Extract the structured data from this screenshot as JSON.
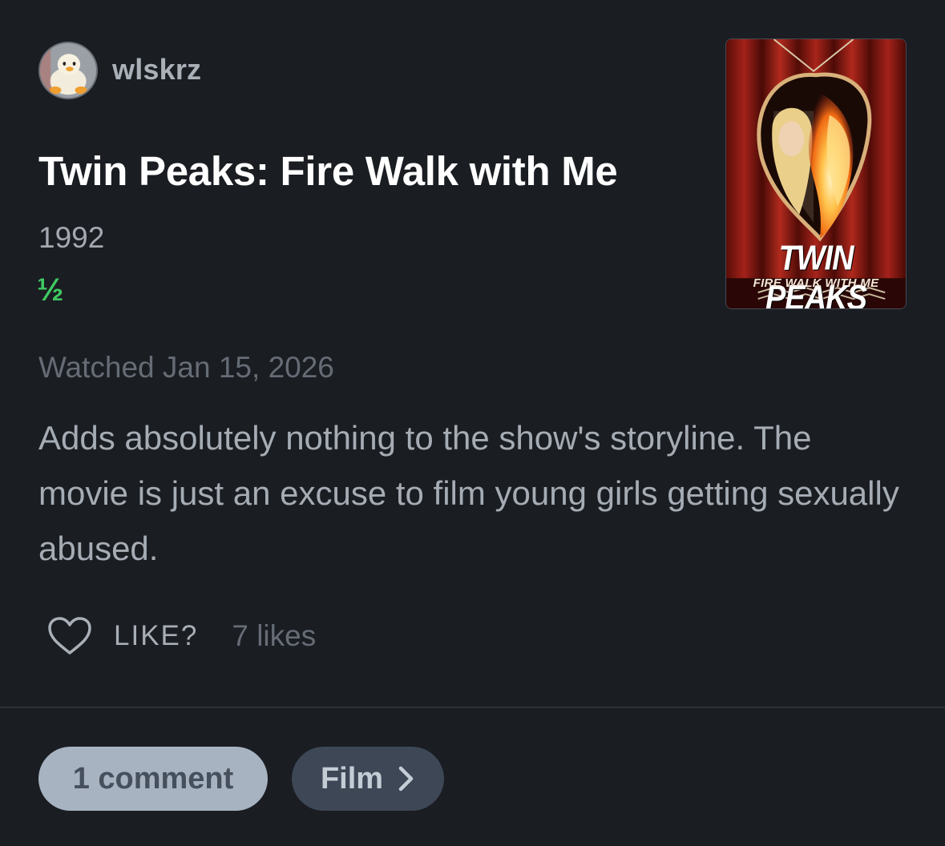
{
  "author": {
    "username": "wlskrz",
    "avatar_icon": "duck-plush-avatar"
  },
  "film": {
    "title": "Twin Peaks: Fire Walk with Me",
    "year": "1992",
    "rating": "½",
    "poster": {
      "title": "TWIN PEAKS",
      "subtitle": "FIRE WALK WITH ME"
    }
  },
  "review": {
    "watched": "Watched Jan 15, 2026",
    "text": "Adds absolutely nothing to the show's storyline. The movie is just an excuse to film young girls getting sexually abused."
  },
  "likes": {
    "icon": "heart-outline-icon",
    "label": "LIKE?",
    "count_text": "7 likes"
  },
  "actions": {
    "comments_label": "1 comment",
    "film_label": "Film",
    "film_icon": "chevron-right-icon"
  },
  "colors": {
    "background": "#1a1d22",
    "rating_green": "#40c862",
    "comments_pill": "#a8b3c2",
    "film_pill": "#3d4756"
  }
}
